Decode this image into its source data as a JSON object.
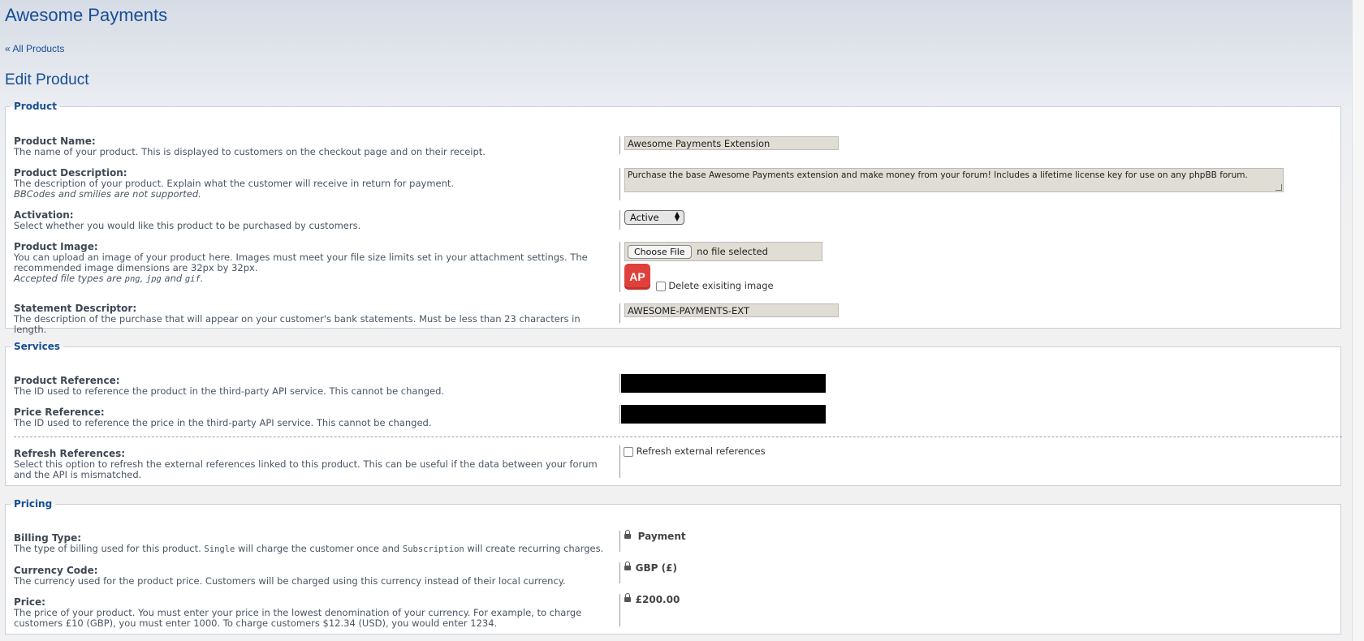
{
  "header": {
    "title": "Awesome Payments",
    "back_link": "« All Products",
    "section_title": "Edit Product"
  },
  "product": {
    "legend": "Product",
    "name": {
      "label": "Product Name:",
      "desc": "The name of your product. This is displayed to customers on the checkout page and on their receipt.",
      "value": "Awesome Payments Extension"
    },
    "description": {
      "label": "Product Description:",
      "desc": "The description of your product. Explain what the customer will receive in return for payment.",
      "note": "BBCodes and smilies are not supported.",
      "value": "Purchase the base Awesome Payments extension and make money from your forum! Includes a lifetime license key for use on any phpBB forum."
    },
    "activation": {
      "label": "Activation:",
      "desc": "Select whether you would like this product to be purchased by customers.",
      "value": "Active"
    },
    "image": {
      "label": "Product Image:",
      "desc": "You can upload an image of your product here. Images must meet your file size limits set in your attachment settings. The recommended image dimensions are 32px by 32px.",
      "note_prefix": "Accepted file types are ",
      "type_png": "png",
      "sep1": ", ",
      "type_jpg": "jpg",
      "sep2": " and ",
      "type_gif": "gif",
      "note_suffix": ".",
      "choose_button": "Choose File",
      "file_status": "no file selected",
      "logo_text": "AP",
      "delete_label": "Delete exisiting image"
    },
    "statement": {
      "label": "Statement Descriptor:",
      "desc": "The description of the purchase that will appear on your customer's bank statements. Must be less than 23 characters in length.",
      "value": "AWESOME-PAYMENTS-EXT"
    }
  },
  "services": {
    "legend": "Services",
    "product_ref": {
      "label": "Product Reference:",
      "desc": "The ID used to reference the product in the third-party API service. This cannot be changed."
    },
    "price_ref": {
      "label": "Price Reference:",
      "desc": "The ID used to reference the price in the third-party API service. This cannot be changed."
    },
    "refresh": {
      "label": "Refresh References:",
      "desc": "Select this option to refresh the external references linked to this product. This can be useful if the data between your forum and the API is mismatched.",
      "checkbox_label": "Refresh external references"
    }
  },
  "pricing": {
    "legend": "Pricing",
    "billing": {
      "label": "Billing Type:",
      "desc_a": "The type of billing used for this product. ",
      "code_single": "Single",
      "desc_b": " will charge the customer once and ",
      "code_sub": "Subscription",
      "desc_c": " will create recurring charges.",
      "value": "Payment"
    },
    "currency": {
      "label": "Currency Code:",
      "desc": "The currency used for the product price. Customers will be charged using this currency instead of their local currency.",
      "value": "GBP (£)"
    },
    "price": {
      "label": "Price:",
      "desc": "The price of your product. You must enter your price in the lowest denomination of your currency. For example, to charge customers £10 (GBP), you must enter 1000. To charge customers $12.34 (USD), you would enter 1234.",
      "value": "£200.00"
    }
  }
}
